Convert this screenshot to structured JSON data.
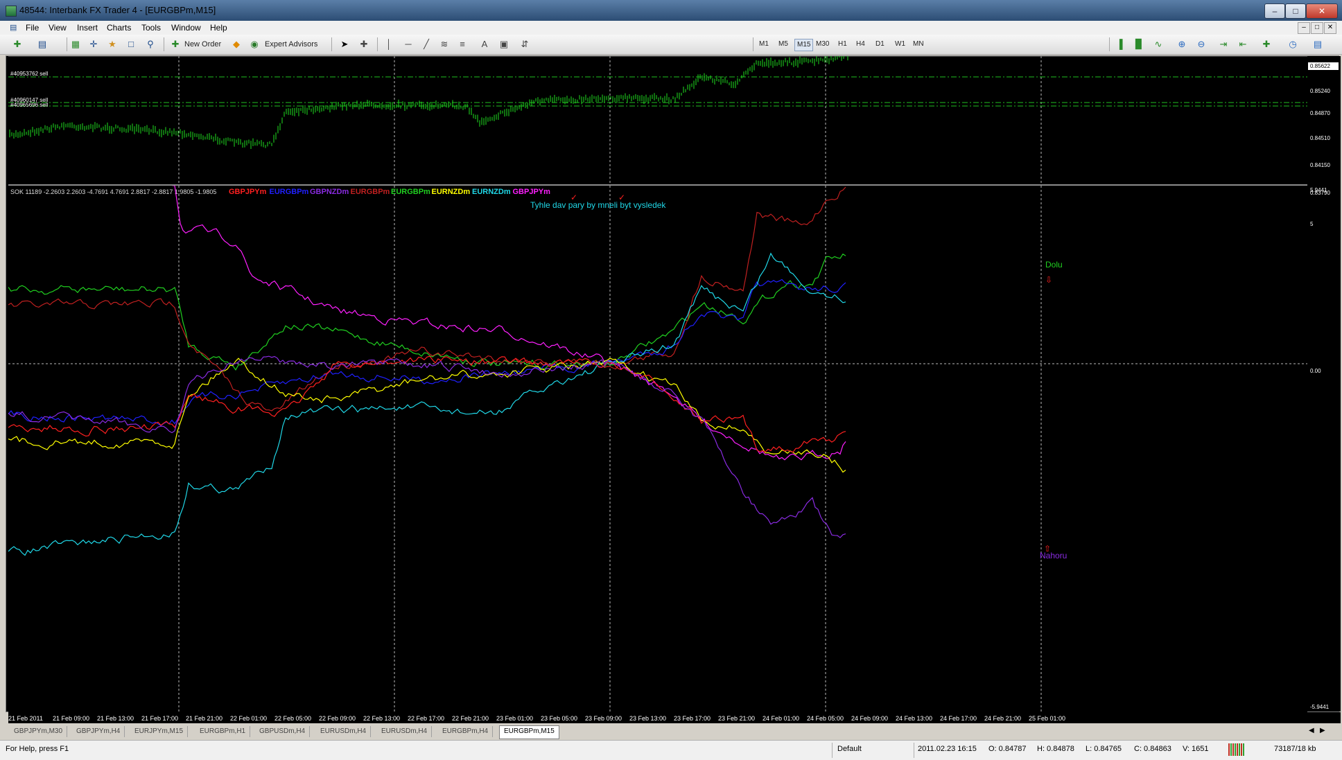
{
  "window": {
    "title": "48544: Interbank FX Trader 4 - [EURGBPm,M15]",
    "buttons": [
      "–",
      "□",
      "✕"
    ]
  },
  "menu": {
    "items": [
      "File",
      "View",
      "Insert",
      "Charts",
      "Tools",
      "Window",
      "Help"
    ]
  },
  "toolbar": {
    "new_order": "New Order",
    "expert_advisors": "Expert Advisors",
    "timeframes": [
      "M1",
      "M5",
      "M15",
      "M30",
      "H1",
      "H4",
      "D1",
      "W1",
      "MN"
    ],
    "active_timeframe": "M15"
  },
  "price_chart": {
    "orders": [
      "#40953762 sell",
      "#40960147 sell",
      "#40965696 sell"
    ],
    "price_labels": [
      "0.85622",
      "0.85240",
      "0.84870",
      "0.84510",
      "0.84150",
      "0.83790"
    ]
  },
  "indicator": {
    "header": "SOK 11189 -2.2603 2.2603 -4.7691 4.7691 2.8817 -2.8817 1.9805 -1.9805",
    "pairs": [
      {
        "label": "GBPJPYm",
        "color": "#ff2020"
      },
      {
        "label": "EURGBPm",
        "color": "#2020ff"
      },
      {
        "label": "GBPNZDm",
        "color": "#8a2be2"
      },
      {
        "label": "EURGBPm",
        "color": "#c02020"
      },
      {
        "label": "EURGBPm",
        "color": "#20d020"
      },
      {
        "label": "EURNZDm",
        "color": "#ffff00"
      },
      {
        "label": "EURNZDm",
        "color": "#20d8e8"
      },
      {
        "label": "GBPJPYm",
        "color": "#ff20ff"
      }
    ],
    "note": "Tyhle dav pary by mneli byt vysledek",
    "label_up": "Dolu",
    "label_down": "Nahoru",
    "scale_labels": [
      "5.9441",
      "5",
      "0.00",
      "-5.9441"
    ]
  },
  "time_axis": [
    "21 Feb 2011",
    "21 Feb 09:00",
    "21 Feb 13:00",
    "21 Feb 17:00",
    "21 Feb 21:00",
    "22 Feb 01:00",
    "22 Feb 05:00",
    "22 Feb 09:00",
    "22 Feb 13:00",
    "22 Feb 17:00",
    "22 Feb 21:00",
    "23 Feb 01:00",
    "23 Feb 05:00",
    "23 Feb 09:00",
    "23 Feb 13:00",
    "23 Feb 17:00",
    "23 Feb 21:00",
    "24 Feb 01:00",
    "24 Feb 05:00",
    "24 Feb 09:00",
    "24 Feb 13:00",
    "24 Feb 17:00",
    "24 Feb 21:00",
    "25 Feb 01:00"
  ],
  "chart_tabs": [
    "GBPJPYm,M30",
    "GBPJPYm,H4",
    "EURJPYm,M15",
    "EURGBPm,H1",
    "GBPUSDm,H4",
    "EURUSDm,H4",
    "EURUSDm,H4",
    "EURGBPm,H4",
    "EURGBPm,M15"
  ],
  "active_tab": "EURGBPm,M15",
  "status": {
    "help": "For Help, press F1",
    "profile": "Default",
    "datetime": "2011.02.23 16:15",
    "open": "O: 0.84787",
    "high": "H: 0.84878",
    "low": "L: 0.84765",
    "close": "C: 0.84863",
    "volume": "V: 1651",
    "traffic": "73187/18 kb"
  }
}
